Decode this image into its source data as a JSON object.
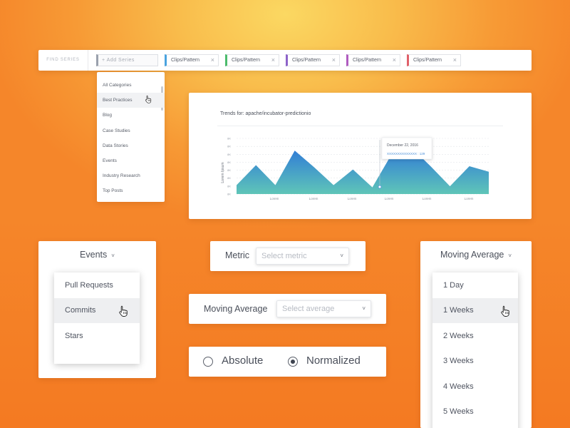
{
  "topbar": {
    "find_series": "FIND SERIES",
    "add_series": "+ Add Series",
    "chips": [
      {
        "label": "Clips/Pattern",
        "close": "×",
        "color": "#4aa3df"
      },
      {
        "label": "Clips/Pattern",
        "close": "×",
        "color": "#4cbb6c"
      },
      {
        "label": "Clips/Pattern",
        "close": "×",
        "color": "#8d63c9"
      },
      {
        "label": "Clips/Pattern",
        "close": "×",
        "color": "#b05cc0"
      },
      {
        "label": "Clips/Pattern",
        "close": "×",
        "color": "#e0606a"
      }
    ]
  },
  "categories": {
    "items": [
      "All Categories",
      "Best Practices",
      "Blog",
      "Case Studies",
      "Data Stories",
      "Events",
      "Industry Research",
      "Top Posts"
    ],
    "hovered_index": 1
  },
  "chart": {
    "title": "Trends for: apache/incubator-predictionio",
    "tooltip_date": "December 22, 2016",
    "tooltip_value": "XXXXXXXXXXXXXX : 129"
  },
  "chart_data": {
    "type": "area",
    "ylabel": "Lorem Ipsum",
    "y_ticks": [
      "8K",
      "8K",
      "8K",
      "8K",
      "8K",
      "8K",
      "8K",
      "8K"
    ],
    "x_ticks": [
      "Lorem",
      "Lorem",
      "Lorem",
      "Lorem",
      "Lorem",
      "Lorem"
    ],
    "grid": true,
    "x": [
      0,
      1,
      2,
      3,
      4,
      5,
      6,
      7,
      8,
      9,
      10,
      11,
      12,
      13
    ],
    "values": [
      0.8,
      2.6,
      0.8,
      3.9,
      2.4,
      0.8,
      2.2,
      0.6,
      3.6,
      4.2,
      2.5,
      0.7,
      2.5,
      2.0
    ],
    "gradient_top": "#2e79d8",
    "gradient_bottom": "#5fc5b8"
  },
  "events": {
    "header": "Events",
    "chevron": "˅",
    "items": [
      "Pull Requests",
      "Commits",
      "Stars"
    ],
    "hovered_index": 1
  },
  "metric": {
    "label": "Metric",
    "placeholder": "Select metric",
    "chevron": "˅"
  },
  "moving_average_field": {
    "label": "Moving Average",
    "placeholder": "Select average",
    "chevron": "˅"
  },
  "radio": {
    "options": [
      "Absolute",
      "Normalized"
    ],
    "selected_index": 1
  },
  "moving_average_menu": {
    "header": "Moving Average",
    "chevron": "˅",
    "items": [
      "1 Day",
      "1 Weeks",
      "2 Weeks",
      "3 Weeks",
      "4 Weeks",
      "5 Weeks"
    ],
    "hovered_index": 1
  }
}
